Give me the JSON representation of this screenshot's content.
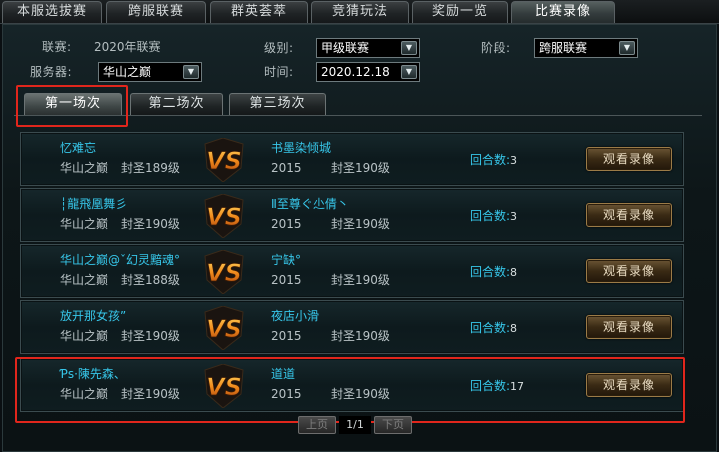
{
  "top_tabs": [
    {
      "label": "本服选拔赛"
    },
    {
      "label": "跨服联赛"
    },
    {
      "label": "群英荟萃"
    },
    {
      "label": "竞猜玩法"
    },
    {
      "label": "奖励一览"
    },
    {
      "label": "比赛录像"
    }
  ],
  "active_top_tab": "比赛录像",
  "filters": {
    "league_label": "联赛:",
    "league_value": "2020年联赛",
    "level_label": "级别:",
    "level_value": "甲级联赛",
    "stage_label": "阶段:",
    "stage_value": "跨服联赛",
    "server_label": "服务器:",
    "server_value": "华山之巅",
    "time_label": "时间:",
    "time_value": "2020.12.18"
  },
  "round_tabs": [
    {
      "label": "第一场次"
    },
    {
      "label": "第二场次"
    },
    {
      "label": "第三场次"
    }
  ],
  "active_round_tab": "第一场次",
  "matches": [
    {
      "p1_name": "忆难忘",
      "p1_server": "华山之巅",
      "p1_rank": "封圣189级",
      "p2_name": "书墨染倾城",
      "p2_server": "2015",
      "p2_rank": "封圣190级",
      "rounds_label": "回合数:",
      "rounds": "3",
      "button": "观看录像"
    },
    {
      "p1_name": "┆龍飛凰舞彡",
      "p1_server": "华山之巅",
      "p1_rank": "封圣190级",
      "p2_name": "Ⅱ至尊ぐ尐倩丶",
      "p2_server": "2015",
      "p2_rank": "封圣190级",
      "rounds_label": "回合数:",
      "rounds": "3",
      "button": "观看录像"
    },
    {
      "p1_name": "华山之巅@ˇ幻灵黯魂°",
      "p1_server": "华山之巅",
      "p1_rank": "封圣188级",
      "p2_name": "宁缺°",
      "p2_server": "2015",
      "p2_rank": "封圣190级",
      "rounds_label": "回合数:",
      "rounds": "8",
      "button": "观看录像"
    },
    {
      "p1_name": "放开那女孩”",
      "p1_server": "华山之巅",
      "p1_rank": "封圣190级",
      "p2_name": "夜店小滑",
      "p2_server": "2015",
      "p2_rank": "封圣190级",
      "rounds_label": "回合数:",
      "rounds": "8",
      "button": "观看录像"
    },
    {
      "p1_name": "Ƥs·陳先森、",
      "p1_server": "华山之巅",
      "p1_rank": "封圣190级",
      "p2_name": "道道",
      "p2_server": "2015",
      "p2_rank": "封圣190级",
      "rounds_label": "回合数:",
      "rounds": "17",
      "button": "观看录像"
    }
  ],
  "vs_text": "VS",
  "pagination": {
    "prev": "上页",
    "info": "1/1",
    "next": "下页"
  },
  "colors": {
    "player_name": "#37c7ea",
    "highlight": "#e1261c",
    "vs": "#f08a1c"
  }
}
